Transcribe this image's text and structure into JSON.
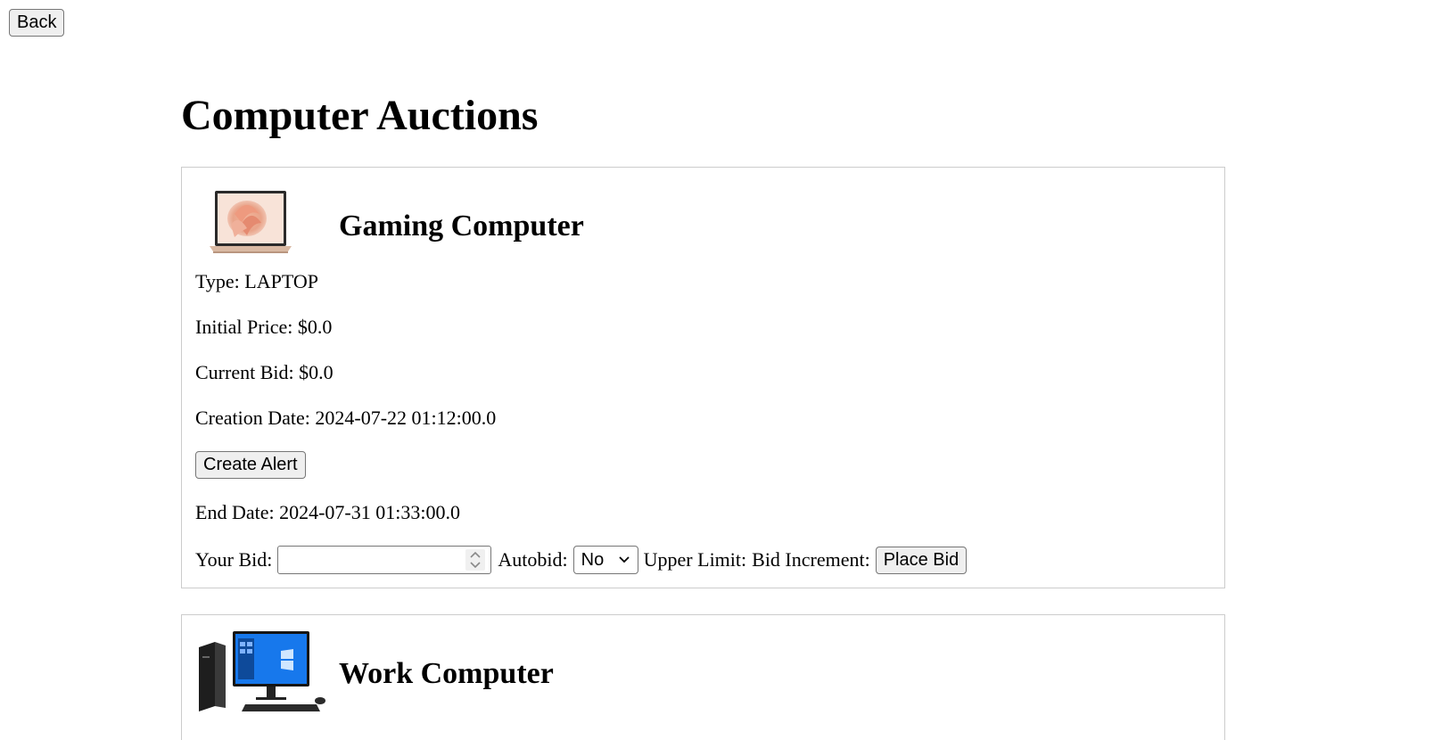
{
  "back_label": "Back",
  "page_title": "Computer Auctions",
  "auctions": [
    {
      "name": "Gaming Computer",
      "image": "laptop-image",
      "type_text": "Type: LAPTOP",
      "initial_price_text": "Initial Price: $0.0",
      "current_bid_text": "Current Bid: $0.0",
      "creation_date_text": "Creation Date: 2024-07-22 01:12:00.0",
      "create_alert_label": "Create Alert",
      "end_date_text": "End Date: 2024-07-31 01:33:00.0",
      "bid_form": {
        "your_bid_label": "Your Bid:",
        "your_bid_value": "",
        "autobid_label": "Autobid:",
        "autobid_selected": "No",
        "upper_limit_label": "Upper Limit:",
        "bid_increment_label": "Bid Increment:",
        "place_bid_label": "Place Bid"
      }
    },
    {
      "name": "Work Computer",
      "image": "desktop-image"
    }
  ]
}
